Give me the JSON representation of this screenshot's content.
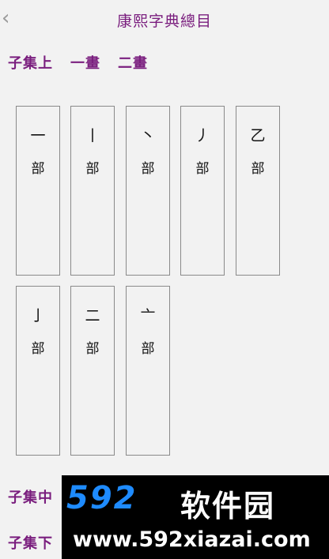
{
  "header": {
    "back_glyph": "‹",
    "title": "康熙字典總目"
  },
  "sections": [
    "子集上",
    "一畫",
    "二畫"
  ],
  "cards": [
    {
      "radical": "一",
      "suffix": "部"
    },
    {
      "radical": "丨",
      "suffix": "部"
    },
    {
      "radical": "丶",
      "suffix": "部"
    },
    {
      "radical": "丿",
      "suffix": "部"
    },
    {
      "radical": "乙",
      "suffix": "部"
    },
    {
      "radical": "亅",
      "suffix": "部"
    },
    {
      "radical": "二",
      "suffix": "部"
    },
    {
      "radical": "亠",
      "suffix": "部"
    }
  ],
  "bottom_sections": [
    "子集中",
    "子集下"
  ],
  "watermark": {
    "brand_number": "592",
    "brand_cn": "软件园",
    "url": "www.592xiazai.com"
  }
}
